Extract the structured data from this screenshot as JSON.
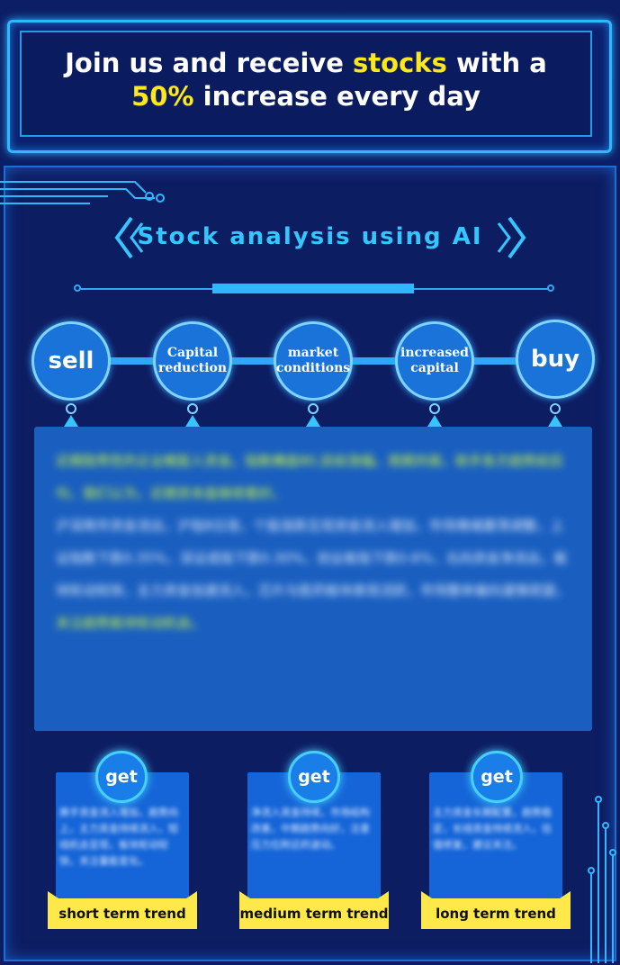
{
  "banner": {
    "line1_pre": "Join us and receive ",
    "line1_hl": "stocks",
    "line1_post": " with a",
    "line2_hl": "50%",
    "line2_post": " increase every day"
  },
  "section": {
    "title": "Stock analysis using AI"
  },
  "steps": [
    {
      "label": "sell"
    },
    {
      "label": "Capital reduction"
    },
    {
      "label": "market conditions"
    },
    {
      "label": "increased capital"
    },
    {
      "label": "buy"
    }
  ],
  "analysis": {
    "paragraph1": "近期隐秀性的企业概股人资金。指数横盘80,目前涨幅。周期共振，助手各方趋势前后均，我们认为，近期资本盘继续看好。",
    "paragraph2": "沪深两市资金流出，沪指8日涨，个股涨跌互现资金流入增加，市场情绪震荡调整，上证指数下跌0.35%，深证成指下跌0.30%，创业板指下跌0.6%，北向资金净流出，板块轮动较快，主力资金加速流入，芯片与医药板块表现活跃，市场整体偏向谨慎观望。",
    "highlight": "关注趋势板块轮动机会。"
  },
  "cards": [
    {
      "button": "get",
      "text": "换手资金流入增加，趋势向上，主力资金持续流入，短线机会显现，板块轮动较快，关注量能变化。",
      "label": "short term trend"
    },
    {
      "button": "get",
      "text": "净流入资金持续，市场结构改善，中期趋势向好，注意压力位附近的波动。",
      "label": "medium term trend"
    },
    {
      "button": "get",
      "text": "主力资金长期配置，趋势稳定，长线资金持续流入，估值修复，建议关注。",
      "label": "long term trend"
    }
  ],
  "colors": {
    "accent": "#2fb8ff",
    "highlight": "#ffe81a",
    "ribbon": "#ffe84a"
  }
}
